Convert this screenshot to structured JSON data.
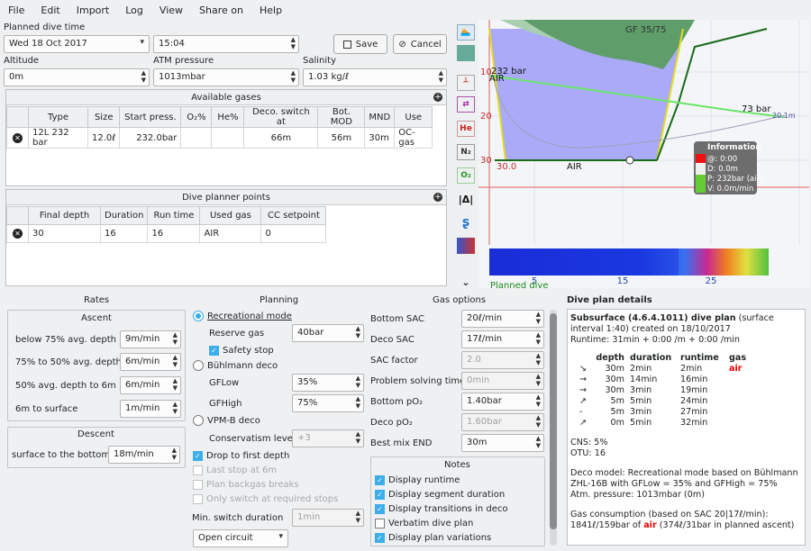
{
  "menu": [
    "File",
    "Edit",
    "Import",
    "Log",
    "View",
    "Share on",
    "Help"
  ],
  "plan": {
    "title": "Planned dive time",
    "date": "Wed 18 Oct 2017",
    "time": "15:04",
    "save": "Save",
    "cancel": "Cancel",
    "altitude_label": "Altitude",
    "altitude": "0m",
    "atm_label": "ATM pressure",
    "atm": "1013mbar",
    "salinity_label": "Salinity",
    "salinity": "1.03 kg/ℓ"
  },
  "gases": {
    "title": "Available gases",
    "headers": [
      "",
      "Type",
      "Size",
      "Start press.",
      "O₂%",
      "He%",
      "Deco. switch at",
      "Bot. MOD",
      "MND",
      "Use"
    ],
    "row": [
      "",
      "12L 232 bar",
      "12.0ℓ",
      "232.0bar",
      "",
      "",
      "66m",
      "56m",
      "30m",
      "OC-gas"
    ]
  },
  "points": {
    "title": "Dive planner points",
    "headers": [
      "",
      "Final depth",
      "Duration",
      "Run time",
      "Used gas",
      "CC setpoint"
    ],
    "row": [
      "",
      "30",
      "16",
      "16",
      "AIR",
      "0"
    ]
  },
  "profile": {
    "ceiling_label": "GF 35/75",
    "pressure_label": "232 bar",
    "gas_left": "AIR",
    "gas_bottom": "AIR",
    "end_pressure": "73 bar",
    "max_depth": "20.1m",
    "depth_start": "30.0",
    "y_ticks": [
      "10",
      "20",
      "30"
    ],
    "x_ticks": [
      "5",
      "15",
      "25"
    ],
    "planned_label": "Planned dive",
    "info": {
      "title": "Information",
      "lines": [
        "@: 0:00",
        "D: 0.0m",
        "P: 232bar (air)",
        "V: 0.0m/min"
      ]
    }
  },
  "rates": {
    "title": "Rates",
    "ascent_title": "Ascent",
    "ascent": [
      {
        "label": "below 75% avg. depth",
        "value": "9m/min"
      },
      {
        "label": "75% to 50% avg. depth",
        "value": "6m/min"
      },
      {
        "label": "50% avg. depth to 6m",
        "value": "6m/min"
      },
      {
        "label": "6m to surface",
        "value": "1m/min"
      }
    ],
    "descent_title": "Descent",
    "descent": [
      {
        "label": "surface to the bottom",
        "value": "18m/min"
      }
    ]
  },
  "planning": {
    "title": "Planning",
    "rec": "Recreational mode",
    "reserve_label": "Reserve gas",
    "reserve": "40bar",
    "safety": "Safety stop",
    "buhl": "Bühlmann deco",
    "gflow_label": "GFLow",
    "gflow": "35%",
    "gfhigh_label": "GFHigh",
    "gfhigh": "75%",
    "vpm": "VPM-B deco",
    "cons_label": "Conservatism level",
    "cons": "+3",
    "drop": "Drop to first depth",
    "last": "Last stop at 6m",
    "backgas": "Plan backgas breaks",
    "onlyswitch": "Only switch at required stops",
    "minswitch_label": "Min. switch duration",
    "minswitch": "1min",
    "circuit": "Open circuit"
  },
  "gasopts": {
    "title": "Gas options",
    "rows": [
      {
        "label": "Bottom SAC",
        "value": "20ℓ/min"
      },
      {
        "label": "Deco SAC",
        "value": "17ℓ/min"
      },
      {
        "label": "SAC factor",
        "value": "2.0"
      },
      {
        "label": "Problem solving time",
        "value": "0min"
      },
      {
        "label": "Bottom pO₂",
        "value": "1.40bar"
      },
      {
        "label": "Deco pO₂",
        "value": "1.60bar"
      },
      {
        "label": "Best mix END",
        "value": "30m"
      }
    ]
  },
  "notes": {
    "title": "Notes",
    "items": [
      "Display runtime",
      "Display segment duration",
      "Display transitions in deco",
      "Verbatim dive plan",
      "Display plan variations"
    ]
  },
  "details": {
    "title": "Dive plan details",
    "head": "Subsurface (4.6.4.1011) dive plan",
    "head_rest": " (surface interval 1:40) created on 18/10/2017",
    "runtime": "Runtime: 31min + 0:00 /m + 0:00 /min",
    "cols": [
      "depth",
      "duration",
      "runtime",
      "gas"
    ],
    "rows": [
      [
        "↘",
        "30m",
        "2min",
        "2min",
        "air"
      ],
      [
        "→",
        "30m",
        "14min",
        "16min",
        ""
      ],
      [
        "→",
        "30m",
        "3min",
        "19min",
        ""
      ],
      [
        "↗",
        "5m",
        "5min",
        "24min",
        ""
      ],
      [
        "-",
        "5m",
        "3min",
        "27min",
        ""
      ],
      [
        "↗",
        "0m",
        "5min",
        "32min",
        ""
      ]
    ],
    "cns": "CNS: 5%",
    "otu": "OTU: 16",
    "deco1": "Deco model: Recreational mode based on Bühlmann",
    "deco2": "ZHL-16B with GFLow = 35% and GFHigh = 75%",
    "atm": "Atm. pressure: 1013mbar (0m)",
    "gas1": "Gas consumption (based on SAC 20|17ℓ/min):",
    "gas2a": "1841ℓ/159bar of ",
    "gas2b": "air",
    "gas2c": " (374ℓ/31bar in planned ascent)"
  }
}
